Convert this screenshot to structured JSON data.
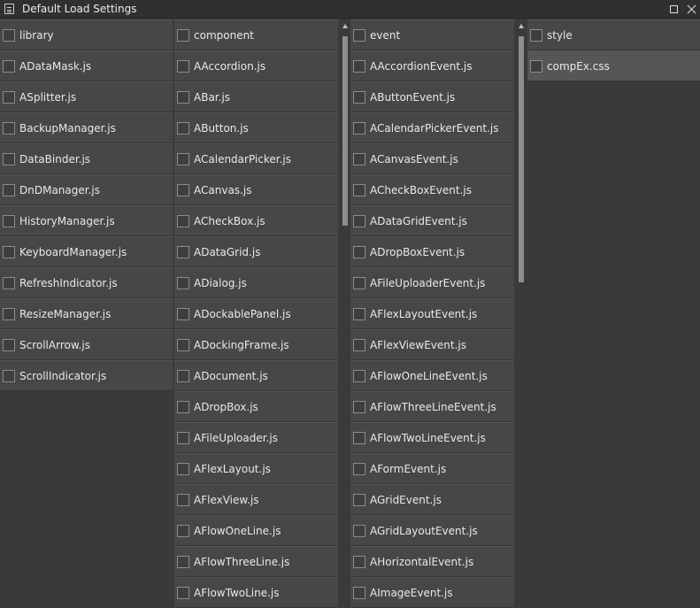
{
  "window": {
    "title": "Default Load Settings"
  },
  "columns": [
    {
      "header": "library",
      "items": [
        "ADataMask.js",
        "ASplitter.js",
        "BackupManager.js",
        "DataBinder.js",
        "DnDManager.js",
        "HistoryManager.js",
        "KeyboardManager.js",
        "RefreshIndicator.js",
        "ResizeManager.js",
        "ScrollArrow.js",
        "ScrollIndicator.js"
      ]
    },
    {
      "header": "component",
      "items": [
        "AAccordion.js",
        "ABar.js",
        "AButton.js",
        "ACalendarPicker.js",
        "ACanvas.js",
        "ACheckBox.js",
        "ADataGrid.js",
        "ADialog.js",
        "ADockablePanel.js",
        "ADockingFrame.js",
        "ADocument.js",
        "ADropBox.js",
        "AFileUploader.js",
        "AFlexLayout.js",
        "AFlexView.js",
        "AFlowOneLine.js",
        "AFlowThreeLine.js",
        "AFlowTwoLine.js"
      ]
    },
    {
      "header": "event",
      "items": [
        "AAccordionEvent.js",
        "AButtonEvent.js",
        "ACalendarPickerEvent.js",
        "ACanvasEvent.js",
        "ACheckBoxEvent.js",
        "ADataGridEvent.js",
        "ADropBoxEvent.js",
        "AFileUploaderEvent.js",
        "AFlexLayoutEvent.js",
        "AFlexViewEvent.js",
        "AFlowOneLineEvent.js",
        "AFlowThreeLineEvent.js",
        "AFlowTwoLineEvent.js",
        "AFormEvent.js",
        "AGridEvent.js",
        "AGridLayoutEvent.js",
        "AHorizontalEvent.js",
        "AImageEvent.js"
      ]
    },
    {
      "header": "style",
      "items": [
        "compEx.css"
      ],
      "selected_item": "compEx.css"
    }
  ]
}
